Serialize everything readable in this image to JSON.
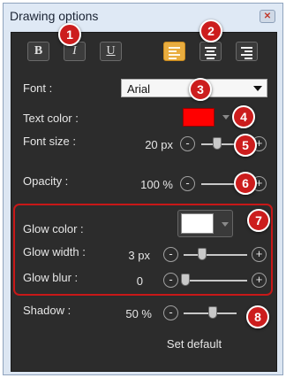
{
  "window": {
    "title": "Drawing options",
    "close_icon": "close-icon"
  },
  "format_buttons": {
    "bold": "B",
    "italic": "I",
    "underline": "U"
  },
  "align": {
    "selected": "left"
  },
  "font": {
    "label": "Font :",
    "value": "Arial"
  },
  "text_color": {
    "label": "Text color :",
    "color": "#ff0000"
  },
  "font_size": {
    "label": "Font size :",
    "value": "20 px",
    "level": 0.3
  },
  "opacity": {
    "label": "Opacity :",
    "value": "100 %",
    "level": 1.0
  },
  "glow_color": {
    "label": "Glow color :",
    "color": "#ffffff"
  },
  "glow_width": {
    "label": "Glow width :",
    "value": "3 px",
    "level": 0.3
  },
  "glow_blur": {
    "label": "Glow blur :",
    "value": "0",
    "level": 0.0
  },
  "shadow": {
    "label": "Shadow :",
    "value": "50 %",
    "level": 0.5
  },
  "set_default": "Set default",
  "badges": [
    "1",
    "2",
    "3",
    "4",
    "5",
    "6",
    "7",
    "8"
  ],
  "minus": "-",
  "plus": "+",
  "highlight_color": "#cc1d1d",
  "accent_color": "#e9ad3f"
}
